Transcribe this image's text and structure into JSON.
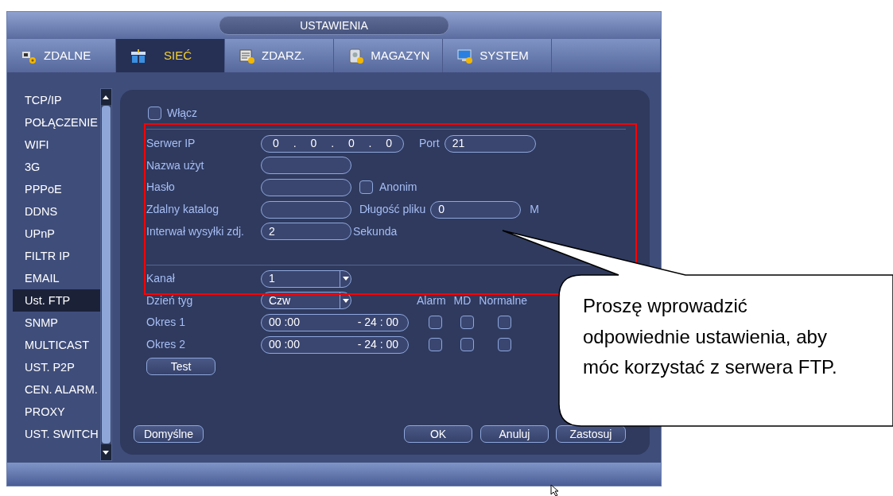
{
  "window": {
    "title": "USTAWIENIA"
  },
  "tabs": [
    {
      "label": "ZDALNE",
      "selected": false
    },
    {
      "label": "SIEĆ",
      "selected": true
    },
    {
      "label": "ZDARZ.",
      "selected": false
    },
    {
      "label": "MAGAZYN",
      "selected": false
    },
    {
      "label": "SYSTEM",
      "selected": false
    }
  ],
  "sidebar": {
    "items": [
      {
        "label": "TCP/IP",
        "selected": false
      },
      {
        "label": "POŁĄCZENIE",
        "selected": false
      },
      {
        "label": "WIFI",
        "selected": false
      },
      {
        "label": "3G",
        "selected": false
      },
      {
        "label": "PPPoE",
        "selected": false
      },
      {
        "label": "DDNS",
        "selected": false
      },
      {
        "label": "UPnP",
        "selected": false
      },
      {
        "label": "FILTR IP",
        "selected": false
      },
      {
        "label": "EMAIL",
        "selected": false
      },
      {
        "label": "Ust. FTP",
        "selected": true
      },
      {
        "label": "SNMP",
        "selected": false
      },
      {
        "label": "MULTICAST",
        "selected": false
      },
      {
        "label": "UST. P2P",
        "selected": false
      },
      {
        "label": "CEN. ALARM.",
        "selected": false
      },
      {
        "label": "PROXY",
        "selected": false
      },
      {
        "label": "UST. SWITCH",
        "selected": false
      }
    ]
  },
  "ftp": {
    "enable": {
      "label": "Włącz",
      "checked": false
    },
    "server_ip": {
      "label": "Serwer IP",
      "value": "0 . 0 . 0 . 0"
    },
    "port": {
      "label": "Port",
      "value": "21"
    },
    "username": {
      "label": "Nazwa użyt"
    },
    "password": {
      "label": "Hasło"
    },
    "anonymous": {
      "label": "Anonim",
      "checked": false
    },
    "remote_dir": {
      "label": "Zdalny katalog"
    },
    "file_length": {
      "label": "Długość pliku",
      "value": "0",
      "unit": "M"
    },
    "upload_interval": {
      "label": "Interwał wysyłki zdj.",
      "value": "2",
      "unit": "Sekunda"
    },
    "channel": {
      "label": "Kanał",
      "value": "1"
    },
    "weekday": {
      "label": "Dzień tyg",
      "value": "Czw"
    },
    "trigger_columns": [
      "Alarm",
      "MD",
      "Normalne"
    ],
    "periods": [
      {
        "label": "Okres 1",
        "start": "00 :00",
        "end": "- 24 : 00",
        "alarm": false,
        "md": false,
        "normal": false
      },
      {
        "label": "Okres 2",
        "start": "00 :00",
        "end": "- 24 : 00",
        "alarm": false,
        "md": false,
        "normal": false
      }
    ],
    "test_button": "Test"
  },
  "buttons": {
    "default": "Domyślne",
    "ok": "OK",
    "cancel": "Anuluj",
    "apply": "Zastosuj"
  },
  "callout": {
    "text": "Proszę wprowadzić odpowiednie ustawienia, aby móc korzystać z serwera FTP."
  }
}
